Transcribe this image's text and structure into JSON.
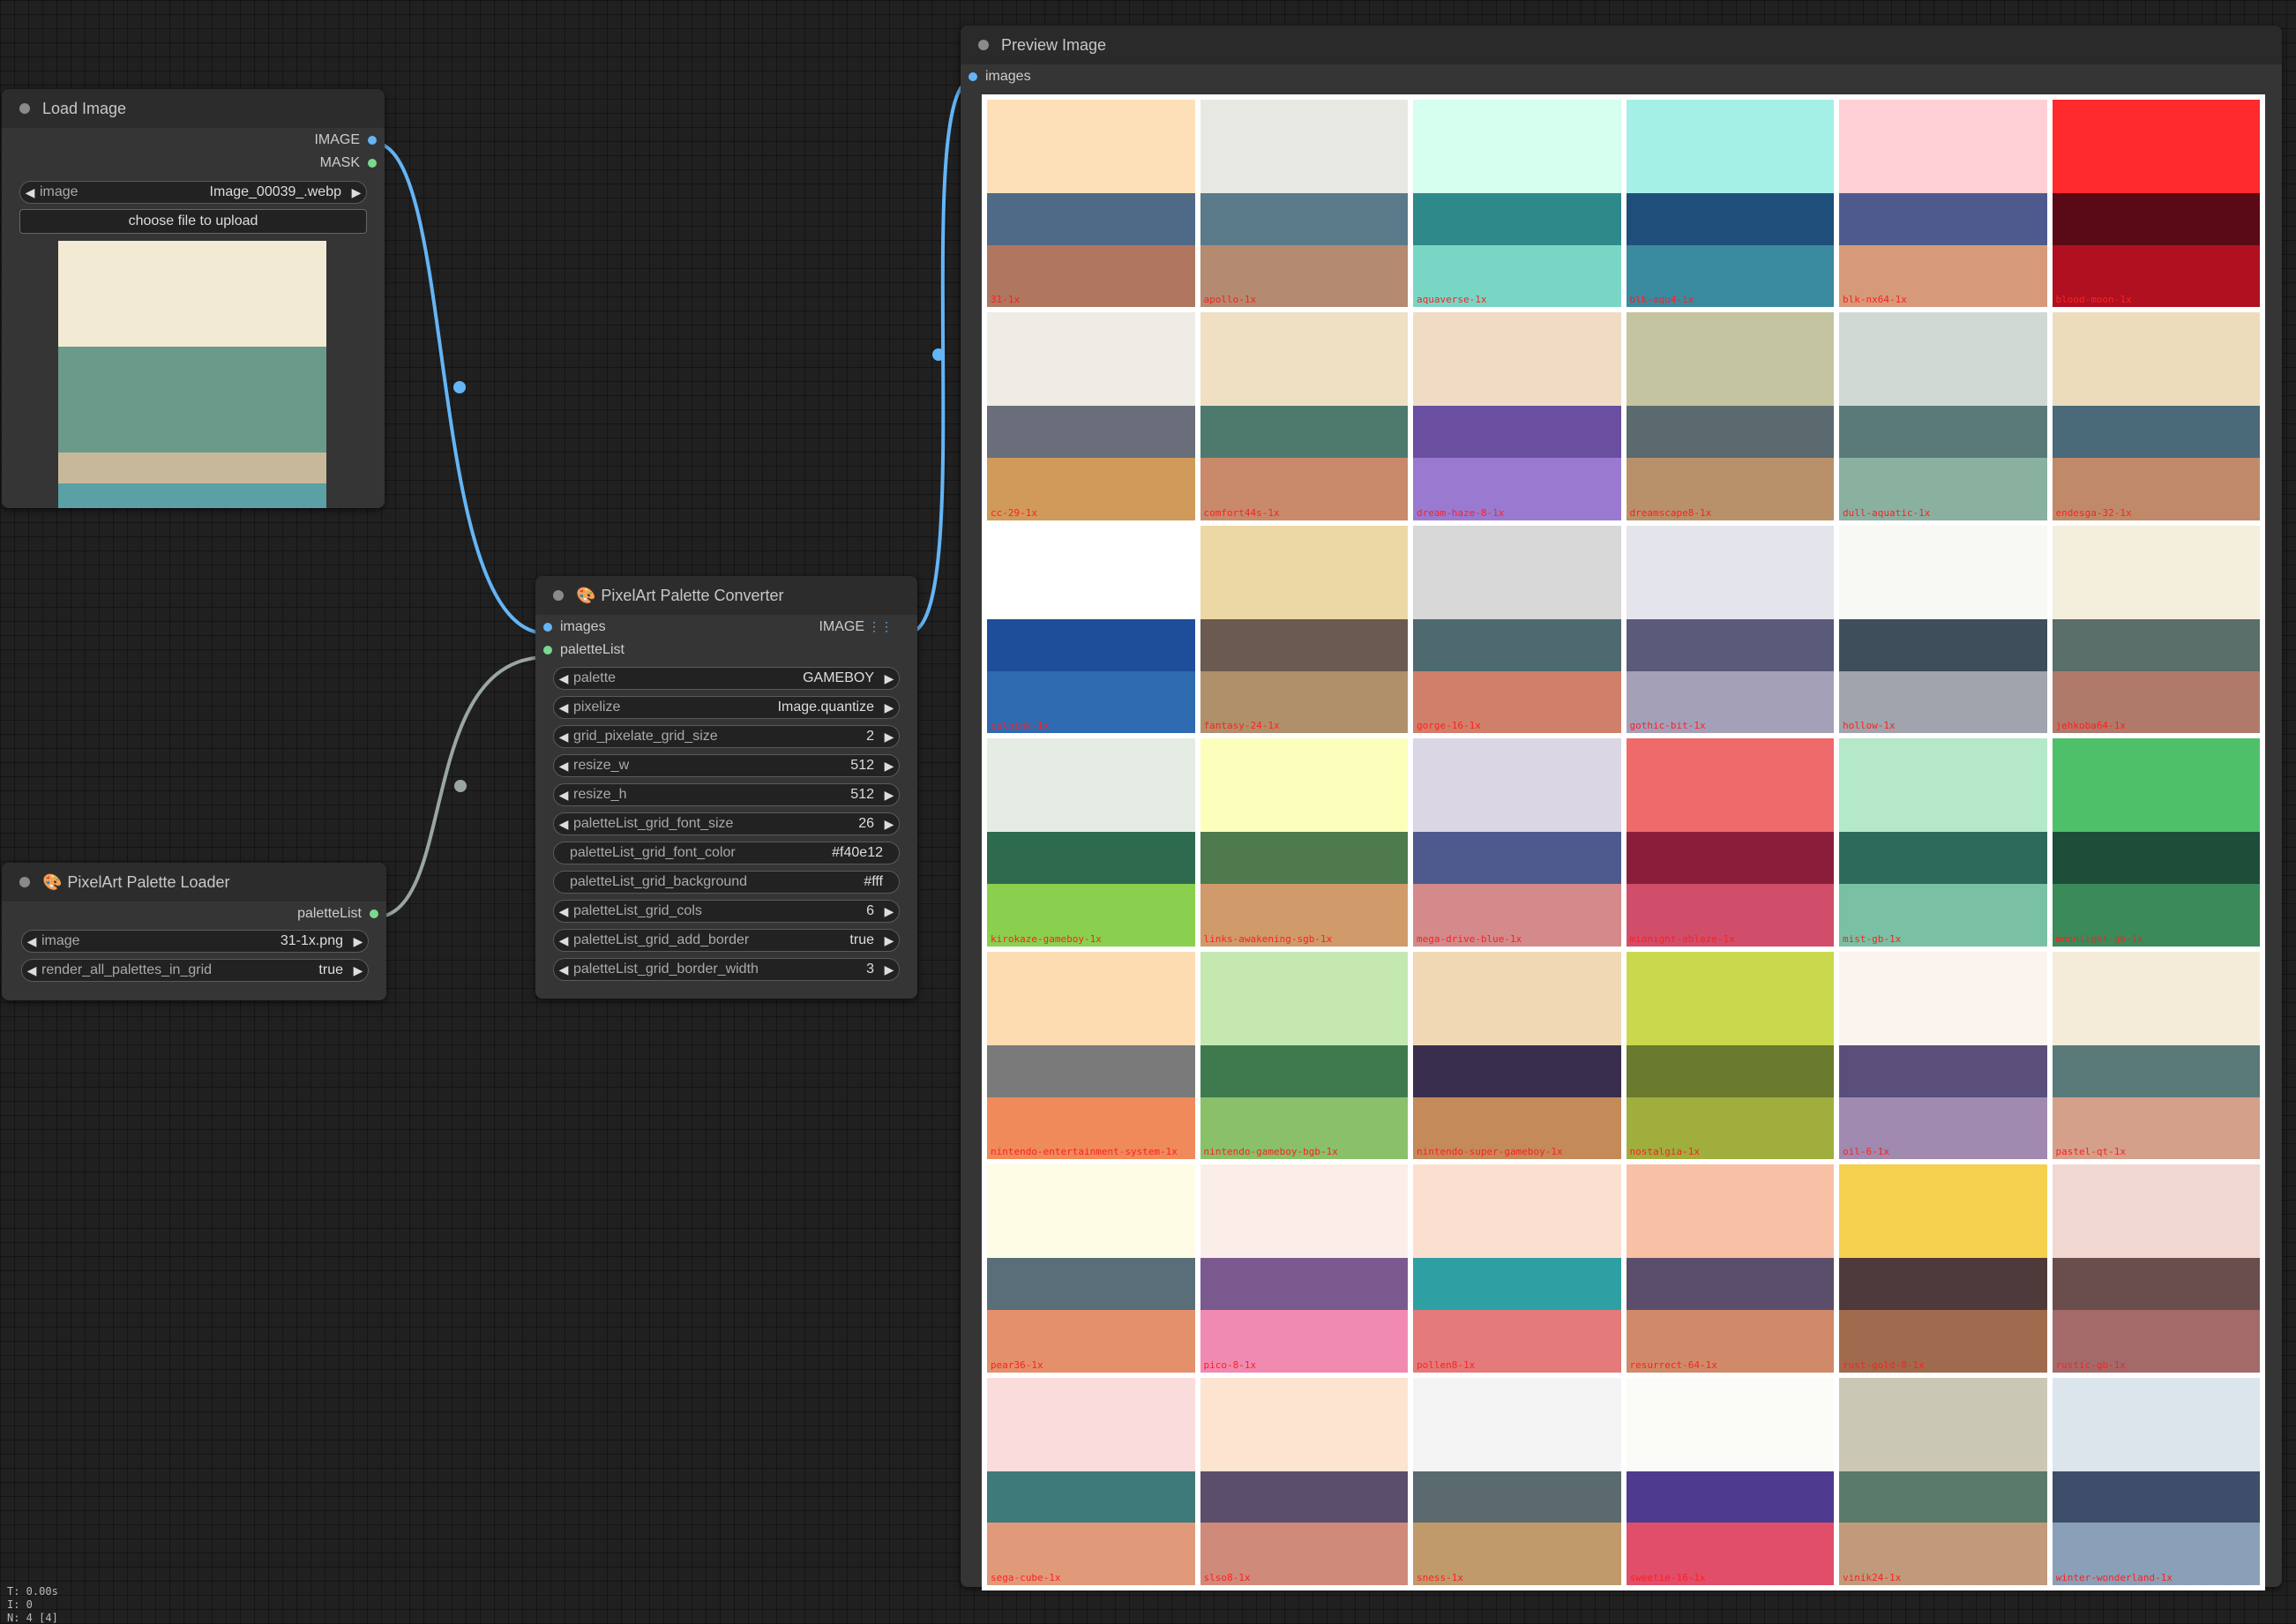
{
  "load_image": {
    "title": "Load Image",
    "outputs": [
      "IMAGE",
      "MASK"
    ],
    "image_widget": {
      "label": "image",
      "value": "Image_00039_.webp"
    },
    "upload_button": "choose file to upload"
  },
  "palette_loader": {
    "title": "PixelArt Palette Loader",
    "output": "paletteList",
    "widgets": [
      {
        "label": "image",
        "value": "31-1x.png"
      },
      {
        "label": "render_all_palettes_in_grid",
        "value": "true"
      }
    ]
  },
  "converter": {
    "title": "PixelArt Palette Converter",
    "inputs": [
      "images",
      "paletteList"
    ],
    "output": "IMAGE",
    "widgets": [
      {
        "label": "palette",
        "value": "GAMEBOY",
        "arrows": true
      },
      {
        "label": "pixelize",
        "value": "Image.quantize",
        "arrows": true
      },
      {
        "label": "grid_pixelate_grid_size",
        "value": "2",
        "arrows": true
      },
      {
        "label": "resize_w",
        "value": "512",
        "arrows": true
      },
      {
        "label": "resize_h",
        "value": "512",
        "arrows": true
      },
      {
        "label": "paletteList_grid_font_size",
        "value": "26",
        "arrows": true
      },
      {
        "label": "paletteList_grid_font_color",
        "value": "#f40e12",
        "arrows": false
      },
      {
        "label": "paletteList_grid_background",
        "value": "#fff",
        "arrows": false
      },
      {
        "label": "paletteList_grid_cols",
        "value": "6",
        "arrows": true
      },
      {
        "label": "paletteList_grid_add_border",
        "value": "true",
        "arrows": true
      },
      {
        "label": "paletteList_grid_border_width",
        "value": "3",
        "arrows": true
      }
    ]
  },
  "preview": {
    "title": "Preview Image",
    "input": "images"
  },
  "palette_grid": [
    {
      "name": "31-1x",
      "colors": [
        "#fde0b8",
        "#4e6a86",
        "#b07660"
      ]
    },
    {
      "name": "apollo-1x",
      "colors": [
        "#e8e8e2",
        "#5a7a8a",
        "#b48a70"
      ]
    },
    {
      "name": "aquaverse-1x",
      "colors": [
        "#d6fff0",
        "#2e8a8a",
        "#7ad6c4"
      ]
    },
    {
      "name": "blk-aqu4-1x",
      "colors": [
        "#a4f0e6",
        "#1e4e7a",
        "#3a8aa0"
      ]
    },
    {
      "name": "blk-nx64-1x",
      "colors": [
        "#ffcfd6",
        "#4e5a8e",
        "#d69a7a"
      ]
    },
    {
      "name": "blood-moon-1x",
      "colors": [
        "#ff2a2e",
        "#5a0a14",
        "#b01020"
      ]
    },
    {
      "name": "cc-29-1x",
      "colors": [
        "#efece6",
        "#6a6e7a",
        "#d09a5a"
      ]
    },
    {
      "name": "comfort44s-1x",
      "colors": [
        "#efe0c4",
        "#4e7a6e",
        "#c88a6a"
      ]
    },
    {
      "name": "dream-haze-8-1x",
      "colors": [
        "#f0dcc4",
        "#6a4ea0",
        "#9a7ad0"
      ]
    },
    {
      "name": "dreamscape8-1x",
      "colors": [
        "#c4c4a0",
        "#5a6a6e",
        "#b8906a"
      ]
    },
    {
      "name": "dull-aquatic-1x",
      "colors": [
        "#d0d8d4",
        "#5a7a7a",
        "#8ab0a0"
      ]
    },
    {
      "name": "endesga-32-1x",
      "colors": [
        "#ecdcbc",
        "#4a6a7a",
        "#c08a6a"
      ]
    },
    {
      "name": "eulbink-1x",
      "colors": [
        "#ffffff",
        "#1e4e9a",
        "#2e6ab0"
      ]
    },
    {
      "name": "fantasy-24-1x",
      "colors": [
        "#ecd8a4",
        "#6a5a50",
        "#b0906a"
      ]
    },
    {
      "name": "gorge-16-1x",
      "colors": [
        "#d8d8d8",
        "#4e6a6e",
        "#d0806a"
      ]
    },
    {
      "name": "gothic-bit-1x",
      "colors": [
        "#e4e4ec",
        "#5a5a7a",
        "#a4a0b8"
      ]
    },
    {
      "name": "hollow-1x",
      "colors": [
        "#f8f8f4",
        "#3e4e5a",
        "#a0a4ac"
      ]
    },
    {
      "name": "jehkoba64-1x",
      "colors": [
        "#f4eedc",
        "#5a6e6a",
        "#b07a6a"
      ]
    },
    {
      "name": "kirokaze-gameboy-1x",
      "colors": [
        "#e4ece4",
        "#2e6a4e",
        "#8ad04e"
      ]
    },
    {
      "name": "links-awakening-sgb-1x",
      "colors": [
        "#fcffbc",
        "#4e7a4e",
        "#d09a6a"
      ]
    },
    {
      "name": "mega-drive-blue-1x",
      "colors": [
        "#dad6e4",
        "#4e5a8e",
        "#d48a8a"
      ]
    },
    {
      "name": "midnight-ablaze-1x",
      "colors": [
        "#ef6a6a",
        "#8a1e3a",
        "#d04e6a"
      ]
    },
    {
      "name": "mist-gb-1x",
      "colors": [
        "#b4e8c8",
        "#2e6a5a",
        "#7ac0a4"
      ]
    },
    {
      "name": "moonlight-gb-1x",
      "colors": [
        "#4ec06a",
        "#1e4e3a",
        "#3a8a5a"
      ]
    },
    {
      "name": "nintendo-entertainment-system-1x",
      "colors": [
        "#fcdcb0",
        "#7a7a7a",
        "#f08a5a"
      ]
    },
    {
      "name": "nintendo-gameboy-bgb-1x",
      "colors": [
        "#c4e8b0",
        "#3e7a4e",
        "#8ac06a"
      ]
    },
    {
      "name": "nintendo-super-gameboy-1x",
      "colors": [
        "#f0d8b4",
        "#3a2e4e",
        "#c48a5a"
      ]
    },
    {
      "name": "nostalgia-1x",
      "colors": [
        "#cad84e",
        "#6a7a2e",
        "#a0ae3e"
      ]
    },
    {
      "name": "oil-6-1x",
      "colors": [
        "#fbf4ee",
        "#5a4e7a",
        "#a08ab0"
      ]
    },
    {
      "name": "pastel-qt-1x",
      "colors": [
        "#f4ecd8",
        "#5a7a7a",
        "#d4a08a"
      ]
    },
    {
      "name": "pear36-1x",
      "colors": [
        "#fdfbe4",
        "#5a6e7a",
        "#e4906a"
      ]
    },
    {
      "name": "pico-8-1x",
      "colors": [
        "#fbeee8",
        "#7a5a8e",
        "#f08ab0"
      ]
    },
    {
      "name": "pollen8-1x",
      "colors": [
        "#fbe0d0",
        "#2ea0a4",
        "#e47a7a"
      ]
    },
    {
      "name": "resurrect-64-1x",
      "colors": [
        "#f8c0a4",
        "#5a4e6a",
        "#d08a6a"
      ]
    },
    {
      "name": "rust-gold-8-1x",
      "colors": [
        "#f4d04e",
        "#4e3a3a",
        "#a06a4e"
      ]
    },
    {
      "name": "rustic-gb-1x",
      "colors": [
        "#f0d8d0",
        "#6a4e4e",
        "#a46a6a"
      ]
    },
    {
      "name": "sega-cube-1x",
      "colors": [
        "#fbdcdc",
        "#3e7a7a",
        "#e09a7a"
      ]
    },
    {
      "name": "slso8-1x",
      "colors": [
        "#fce4d0",
        "#5a4e6a",
        "#d08a7a"
      ]
    },
    {
      "name": "sness-1x",
      "colors": [
        "#f4f4f4",
        "#5a6a6e",
        "#c09a6a"
      ]
    },
    {
      "name": "sweetie-16-1x",
      "colors": [
        "#fbfbf8",
        "#4e3a8e",
        "#e04e6a"
      ]
    },
    {
      "name": "vinik24-1x",
      "colors": [
        "#cac8b4",
        "#5a7a6a",
        "#c09a7a"
      ]
    },
    {
      "name": "winter-wonderland-1x",
      "colors": [
        "#dce4ec",
        "#3e4e6a",
        "#8aa0b8"
      ]
    }
  ],
  "status": [
    "T: 0.00s",
    "I: 0",
    "N: 4 [4]"
  ]
}
